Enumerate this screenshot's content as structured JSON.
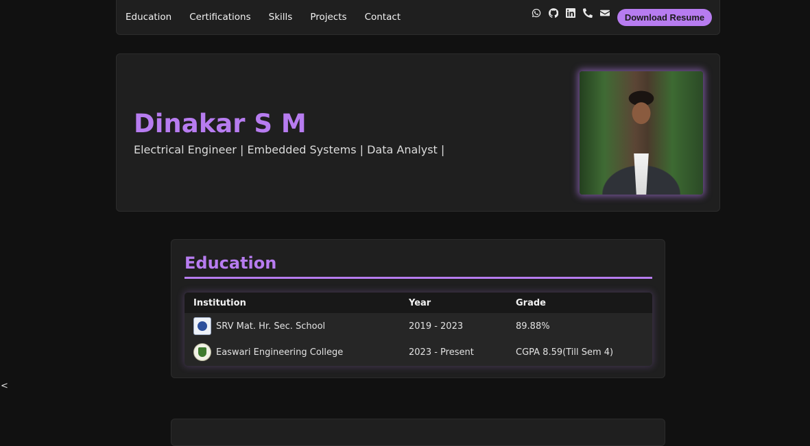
{
  "nav": {
    "links": [
      "Education",
      "Certifications",
      "Skills",
      "Projects",
      "Contact"
    ],
    "icons": [
      "whatsapp-icon",
      "github-icon",
      "linkedin-icon",
      "phone-icon",
      "mail-icon"
    ],
    "resume_button": "Download Resume"
  },
  "hero": {
    "name": "Dinakar S M",
    "subtitle": "Electrical Engineer | Embedded Systems | Data Analyst |"
  },
  "education": {
    "title": "Education",
    "headers": [
      "Institution",
      "Year",
      "Grade"
    ],
    "rows": [
      {
        "institution": "SRV Mat. Hr. Sec. School",
        "year": "2019 - 2023",
        "grade": "89.88%"
      },
      {
        "institution": "Easwari Engineering College",
        "year": "2023 - Present",
        "grade": "CGPA 8.59(Till Sem 4)"
      }
    ]
  },
  "misc": {
    "back_arrow": "<"
  },
  "colors": {
    "accent": "#b77cf0",
    "background": "#111111",
    "card": "#1f1f1f"
  }
}
